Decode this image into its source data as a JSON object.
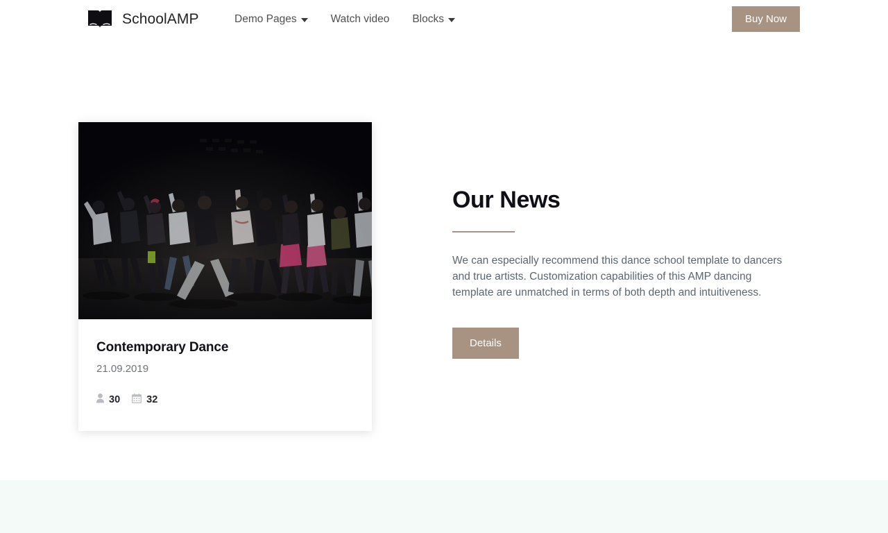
{
  "header": {
    "brand": {
      "icon": "open-book-icon",
      "name": "SchoolAMP"
    },
    "nav": [
      {
        "label": "Demo Pages",
        "has_caret": true
      },
      {
        "label": "Watch video",
        "has_caret": false
      },
      {
        "label": "Blocks",
        "has_caret": true
      }
    ],
    "buy_label": "Buy Now"
  },
  "card": {
    "image_alt": "group-of-dancers-on-dark-stage",
    "title": "Contemporary Dance",
    "date": "21.09.2019",
    "meta": [
      {
        "icon": "user-icon",
        "value": "30"
      },
      {
        "icon": "calendar-icon",
        "value": "32"
      }
    ]
  },
  "news": {
    "title": "Our News",
    "body": "We can especially recommend this dance school template to dancers and true artists. Customization capabilities of this AMP dancing template are unmatched in terms of both depth and intuitiveness.",
    "details_label": "Details"
  },
  "colors": {
    "accent": "#a89383",
    "page_bg": "#ffffff",
    "band_bg": "#f4faf8",
    "heading": "#0f0f16",
    "body_text": "#5b6670"
  }
}
